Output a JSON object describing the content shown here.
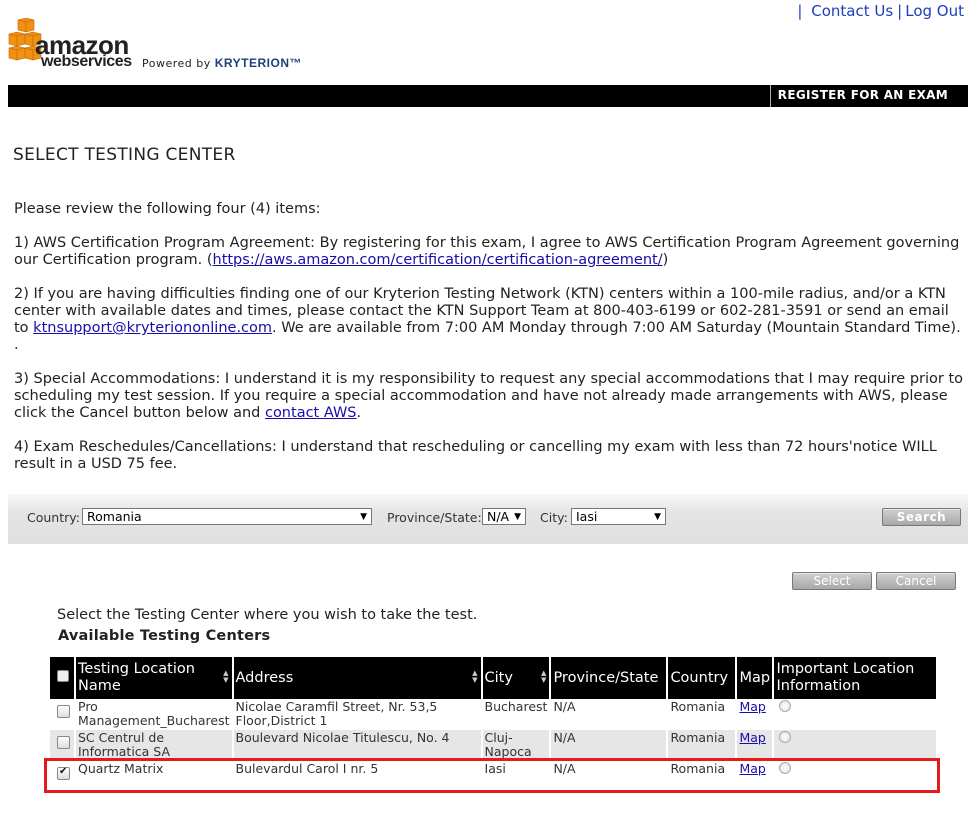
{
  "header": {
    "separator": "|",
    "contact_us": "Contact Us",
    "divider": "|",
    "log_out": "Log Out"
  },
  "logo": {
    "amazon": "amazon",
    "webservices": "webservices",
    "powered_by": "Powered by",
    "kryterion": "KRYTERION™"
  },
  "nav": {
    "register": "REGISTER FOR AN EXAM"
  },
  "page": {
    "title": "SELECT TESTING CENTER"
  },
  "intro": {
    "lead": "Please review the following four (4) items:",
    "item1_text": "1) AWS Certification Program Agreement: By registering for this exam, I agree to AWS Certification Program Agreement governing our Certification program. (",
    "item1_link": "https://aws.amazon.com/certification/certification-agreement/",
    "item1_end": ")",
    "item2_text": "2) If you are having difficulties finding one of our Kryterion Testing Network (KTN) centers within a 100-mile radius, and/or a KTN center with available dates and times, please contact the KTN Support Team at 800-403-6199 or 602-281-3591 or send an email to ",
    "item2_link": "ktnsupport@kryteriononline.com",
    "item2_end": ". We are available from 7:00 AM Monday through 7:00 AM Saturday (Mountain Standard Time). .",
    "item3_text": "3) Special Accommodations: I understand it is my responsibility to request any special accommodations that I may require prior to scheduling my test session. If you require a special accommodation and have not already made arrangements with AWS, please click the Cancel button below and ",
    "item3_link": "contact AWS",
    "item3_end": ".",
    "item4_text": "4) Exam Reschedules/Cancellations: I understand that rescheduling or cancelling my exam with less than 72 hours'notice WILL result in a USD 75 fee."
  },
  "search": {
    "country_label": "Country:",
    "country_value": "Romania",
    "province_label": "Province/State:",
    "province_value": "N/A",
    "city_label": "City:",
    "city_value": "Iasi",
    "search_button": "Search"
  },
  "actions": {
    "select_button": "Select",
    "cancel_button": "Cancel"
  },
  "centers": {
    "instruction": "Select the Testing Center where you wish to take the test.",
    "heading": "Available Testing Centers",
    "columns": {
      "name": "Testing Location Name",
      "address": "Address",
      "city": "City",
      "province": "Province/State",
      "country": "Country",
      "map": "Map",
      "info": "Important Location Information"
    },
    "rows": [
      {
        "name": "Pro Management_Bucharest",
        "address": "Nicolae Caramfil Street, Nr. 53,5 Floor,District 1",
        "city": "Bucharest",
        "province": "N/A",
        "country": "Romania",
        "map": "Map",
        "checked": false
      },
      {
        "name": "SC Centrul de Informatica SA",
        "address": "Boulevard Nicolae Titulescu, No. 4",
        "city": "Cluj-Napoca",
        "province": "N/A",
        "country": "Romania",
        "map": "Map",
        "checked": false
      },
      {
        "name": "Quartz Matrix",
        "address": "Bulevardul Carol I nr. 5",
        "city": "Iasi",
        "province": "N/A",
        "country": "Romania",
        "map": "Map",
        "checked": true
      }
    ]
  },
  "colors": {
    "navbar": "#000000",
    "link": "#1a0dab",
    "highlight": "#e31b1b",
    "logo_orange": "#f29111"
  }
}
